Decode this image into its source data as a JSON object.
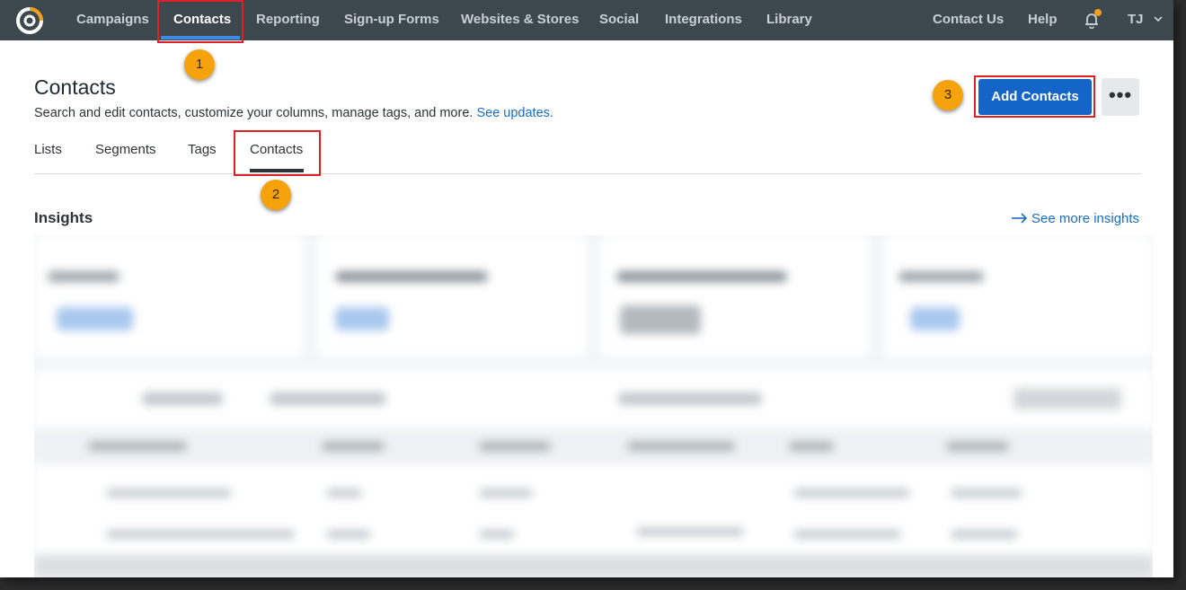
{
  "nav": {
    "items": [
      "Campaigns",
      "Contacts",
      "Reporting",
      "Sign-up Forms",
      "Websites & Stores",
      "Social",
      "Integrations",
      "Library"
    ],
    "right": [
      "Contact Us",
      "Help"
    ],
    "user_initials": "TJ",
    "active": "Contacts"
  },
  "page": {
    "title": "Contacts",
    "subtitle": "Search and edit contacts, customize your columns, manage tags, and more.",
    "subtitle_link": "See updates.",
    "add_button": "Add Contacts",
    "more_button": "•••"
  },
  "tabs": [
    "Lists",
    "Segments",
    "Tags",
    "Contacts"
  ],
  "active_tab": "Contacts",
  "insights": {
    "title": "Insights",
    "see_more": "See more insights"
  },
  "callouts": [
    "1",
    "2",
    "3"
  ],
  "colors": {
    "nav_bg": "#3d474e",
    "accent": "#1565c8",
    "highlight": "#e02027",
    "callout": "#f5a20c"
  }
}
